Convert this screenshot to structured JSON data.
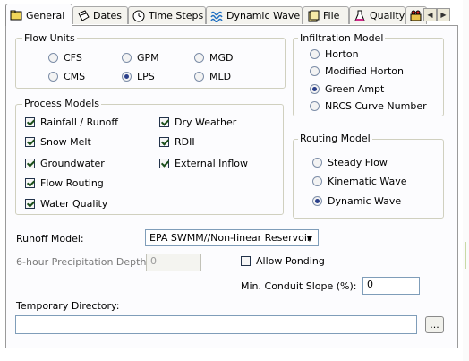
{
  "tabs": [
    {
      "label": "General",
      "icon": "folder-icon",
      "active": true
    },
    {
      "label": "Dates",
      "icon": "calendar-icon",
      "active": false
    },
    {
      "label": "Time Steps",
      "icon": "clock-icon",
      "active": false
    },
    {
      "label": "Dynamic Wave",
      "icon": "wave-icon",
      "active": false
    },
    {
      "label": "File",
      "icon": "file-icon",
      "active": false
    },
    {
      "label": "Quality",
      "icon": "flask-icon",
      "active": false
    }
  ],
  "flow_units": {
    "title": "Flow Units",
    "options": [
      "CFS",
      "GPM",
      "MGD",
      "CMS",
      "LPS",
      "MLD"
    ],
    "selected": "LPS"
  },
  "infiltration": {
    "title": "Infiltration Model",
    "options": [
      "Horton",
      "Modified Horton",
      "Green Ampt",
      "NRCS Curve Number"
    ],
    "selected": "Green Ampt"
  },
  "process_models": {
    "title": "Process Models",
    "items": [
      {
        "label": "Rainfall / Runoff",
        "checked": true
      },
      {
        "label": "Snow Melt",
        "checked": true
      },
      {
        "label": "Groundwater",
        "checked": true
      },
      {
        "label": "Flow Routing",
        "checked": true
      },
      {
        "label": "Water Quality",
        "checked": true
      },
      {
        "label": "Dry Weather",
        "checked": true
      },
      {
        "label": "RDII",
        "checked": true
      },
      {
        "label": "External Inflow",
        "checked": true
      }
    ]
  },
  "routing": {
    "title": "Routing Model",
    "options": [
      "Steady Flow",
      "Kinematic Wave",
      "Dynamic Wave"
    ],
    "selected": "Dynamic Wave"
  },
  "runoff_model": {
    "label": "Runoff Model:",
    "value": "EPA SWMM//Non-linear Reservoir"
  },
  "precip_depth": {
    "label": "6-hour Precipitation Depth:",
    "value": "0"
  },
  "allow_ponding": {
    "label": "Allow Ponding",
    "checked": false
  },
  "min_slope": {
    "label": "Min. Conduit Slope (%):",
    "value": "0"
  },
  "temp_dir": {
    "label": "Temporary Directory:",
    "value": "",
    "browse_label": "..."
  },
  "colors": {
    "accent_radio": "#2a3f8a",
    "panel_bg": "#fcfcfe",
    "group_border": "#d0d0bf"
  }
}
